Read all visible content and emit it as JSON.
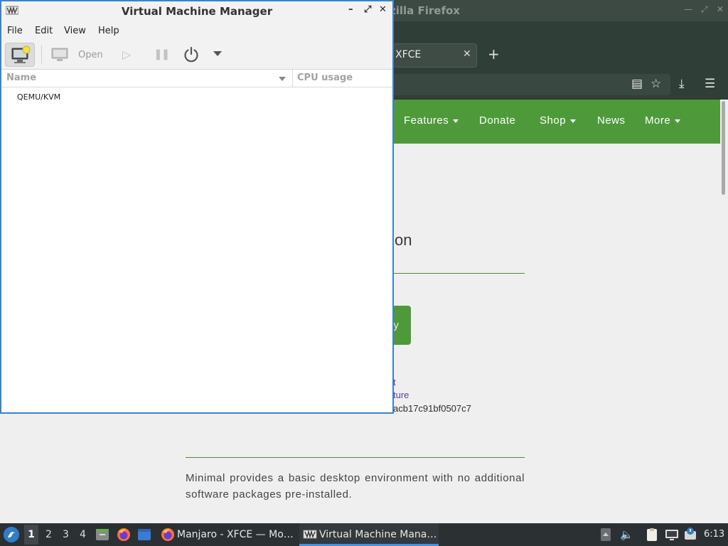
{
  "firefox": {
    "window_title": "zilla Firefox",
    "tab_label": "XFCE",
    "site_nav": [
      {
        "label": "Features",
        "has_dropdown": true
      },
      {
        "label": "Donate",
        "has_dropdown": false
      },
      {
        "label": "Shop",
        "has_dropdown": true
      },
      {
        "label": "News",
        "has_dropdown": false
      },
      {
        "label": "More",
        "has_dropdown": true
      }
    ],
    "page_heading_fragment": "on",
    "button_fragment": "y",
    "link_fragment_1": "t",
    "link_fragment_2": "ture",
    "hash_fragment": "acb17c91bf0507c7",
    "description": "Minimal provides a basic desktop environment with no additional software packages pre-installed.",
    "accent_color": "#4e9a3a"
  },
  "vmm": {
    "window_title": "Virtual Machine Manager",
    "menu": [
      "File",
      "Edit",
      "View",
      "Help"
    ],
    "toolbar": {
      "open_label": "Open"
    },
    "columns": {
      "name": "Name",
      "cpu": "CPU usage"
    },
    "connections": [
      "QEMU/KVM"
    ],
    "border_color": "#3d83c9"
  },
  "taskbar": {
    "workspaces": [
      "1",
      "2",
      "3",
      "4"
    ],
    "active_workspace": "1",
    "tasks": [
      {
        "label": "Manjaro - XFCE — Mo…",
        "icon": "firefox-icon"
      },
      {
        "label": "Virtual Machine Mana…",
        "icon": "virt-manager-icon",
        "active": true
      }
    ],
    "clock": "6:13"
  }
}
